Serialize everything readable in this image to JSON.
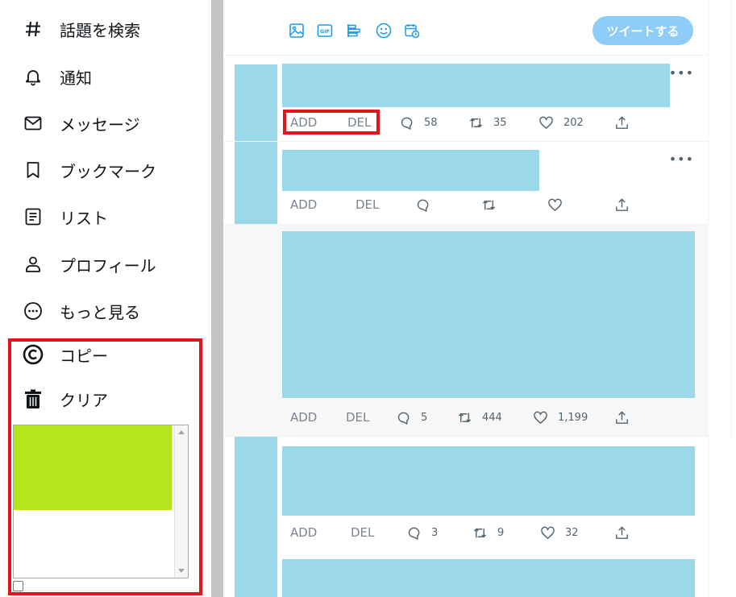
{
  "sidebar": {
    "items": [
      {
        "label": "話題を検索",
        "icon": "hashtag-icon"
      },
      {
        "label": "通知",
        "icon": "bell-icon"
      },
      {
        "label": "メッセージ",
        "icon": "envelope-icon"
      },
      {
        "label": "ブックマーク",
        "icon": "bookmark-icon"
      },
      {
        "label": "リスト",
        "icon": "list-icon"
      },
      {
        "label": "プロフィール",
        "icon": "person-icon"
      },
      {
        "label": "もっと見る",
        "icon": "more-circle-icon"
      }
    ],
    "tools": [
      {
        "label": "コピー",
        "icon": "copyright-icon"
      },
      {
        "label": "クリア",
        "icon": "trash-icon"
      }
    ]
  },
  "compose": {
    "icons": [
      "image-icon",
      "gif-icon",
      "poll-icon",
      "emoji-icon",
      "schedule-icon"
    ],
    "gif_label": "GIF",
    "tweet_button": "ツイートする"
  },
  "tweets": [
    {
      "add": "ADD",
      "del": "DEL",
      "replies": "58",
      "retweets": "35",
      "likes": "202",
      "more": "•••"
    },
    {
      "add": "ADD",
      "del": "DEL",
      "replies": "",
      "retweets": "",
      "likes": "",
      "more": "•••"
    },
    {
      "add": "ADD",
      "del": "DEL",
      "replies": "5",
      "retweets": "444",
      "likes": "1,199"
    },
    {
      "add": "ADD",
      "del": "DEL",
      "replies": "3",
      "retweets": "9",
      "likes": "32"
    }
  ],
  "colors": {
    "accent": "#1d9bf0",
    "placeholder": "#9bd9ea",
    "highlight": "#e0161f",
    "clip_fill": "#b5e61d"
  }
}
